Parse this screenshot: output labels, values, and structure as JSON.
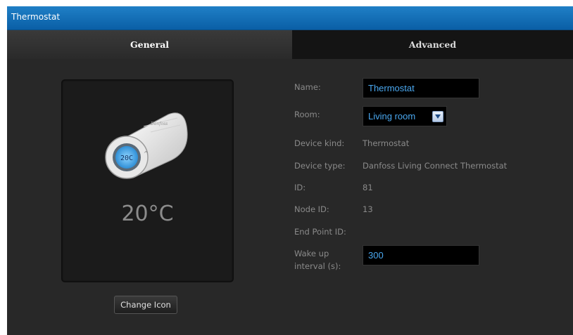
{
  "window": {
    "title": "Thermostat"
  },
  "tabs": {
    "general": "General",
    "advanced": "Advanced"
  },
  "icon_panel": {
    "temperature": "20°C",
    "device_icon": "danfoss-thermostat-icon",
    "display_text": "20C"
  },
  "change_icon_button": "Change Icon",
  "fields": {
    "name": {
      "label": "Name:",
      "value": "Thermostat"
    },
    "room": {
      "label": "Room:",
      "value": "Living room"
    },
    "device_kind": {
      "label": "Device kind:",
      "value": "Thermostat"
    },
    "device_type": {
      "label": "Device type:",
      "value": "Danfoss Living Connect Thermostat"
    },
    "id": {
      "label": "ID:",
      "value": "81"
    },
    "node_id": {
      "label": "Node ID:",
      "value": "13"
    },
    "end_point_id": {
      "label": "End Point ID:",
      "value": ""
    },
    "wake_up": {
      "label_line1": "Wake up",
      "label_line2": "interval (s):",
      "value": "300"
    }
  },
  "colors": {
    "accent": "#1f7fc6",
    "input_text": "#4aa8f0"
  }
}
